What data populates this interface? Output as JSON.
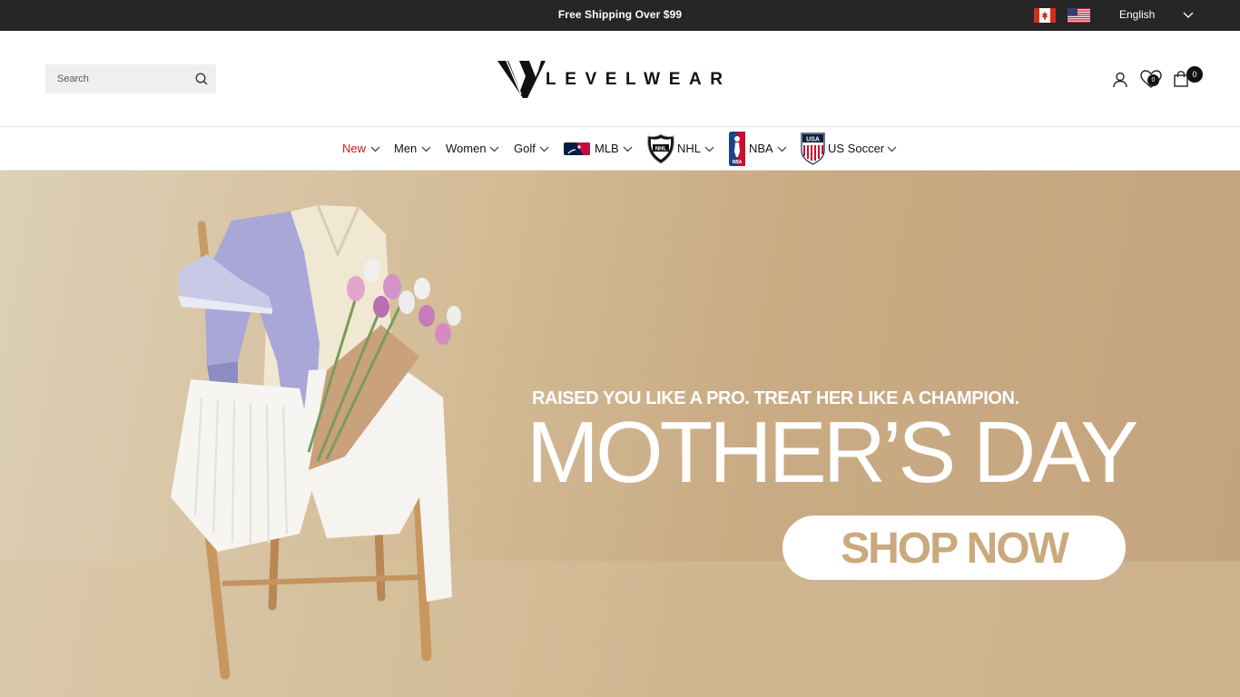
{
  "announcement": {
    "promo_text": "Free Shipping Over $99",
    "flags": [
      "canada-flag-icon",
      "us-flag-icon"
    ],
    "language": "English"
  },
  "header": {
    "search_placeholder": "Search",
    "logo_text": "LEVELWEAR",
    "wishlist_count": "0",
    "cart_count": "0",
    "icons": [
      "search-icon",
      "account-icon",
      "heart-icon",
      "shopping-bag-icon"
    ]
  },
  "nav": {
    "items": [
      {
        "label": "New"
      },
      {
        "label": "Men"
      },
      {
        "label": "Women"
      },
      {
        "label": "Golf"
      },
      {
        "label": "MLB"
      },
      {
        "label": "NHL"
      },
      {
        "label": "NBA"
      },
      {
        "label": "US Soccer"
      }
    ],
    "active_color": "#cc1a1a"
  },
  "hero": {
    "tagline": "RAISED YOU LIKE A PRO. TREAT HER LIKE A CHAMPION.",
    "title": "MOTHER’S DAY",
    "cta": "SHOP NOW",
    "cta_text_color": "#c9a97d"
  },
  "colors": {
    "topbar_bg": "#262626",
    "hero_bg": "#d4bd98"
  }
}
